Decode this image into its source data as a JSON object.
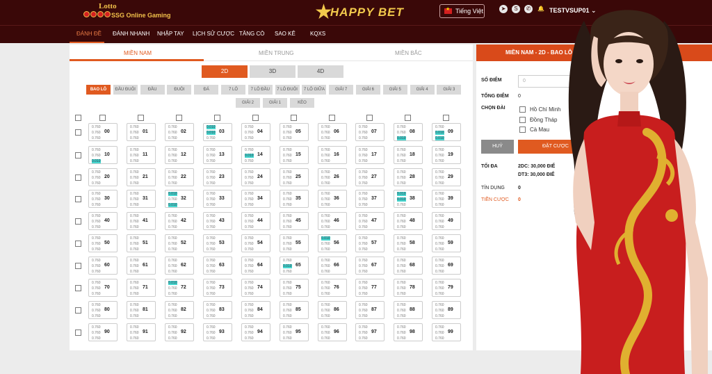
{
  "brand": {
    "lotto_title": "Lotto",
    "lotto_subtitle": "SSG Online Gaming",
    "name": "HAPPY BET"
  },
  "header": {
    "language": "Tiếng Việt",
    "username": "TESTVSUP01"
  },
  "nav": [
    "ĐÁNH ĐỀ",
    "ĐÁNH NHANH",
    "NHẬP TAY",
    "LỊCH SỬ CƯỢC",
    "TĂNG CÒ",
    "SAO KÊ",
    "KQXS"
  ],
  "regions": [
    "MIỀN NAM",
    "MIỀN TRUNG",
    "MIỀN BẮC"
  ],
  "types": [
    "2D",
    "3D",
    "4D"
  ],
  "bet_types_row1": [
    "BAO LÔ",
    "ĐẦU ĐUÔI",
    "ĐẦU",
    "ĐUÔI",
    "ĐÁ",
    "7 LÔ",
    "7 LÔ ĐẦU",
    "7 LÔ ĐUÔI",
    "7 LÔ GIỮA",
    "GIẢI 7",
    "GIẢI 6",
    "GIẢI 5",
    "GIẢI 4",
    "GIẢI 3"
  ],
  "bet_types_row2": [
    "GIẢI 2",
    "GIẢI 1",
    "KÈO"
  ],
  "odds_default": "0.760",
  "odds_highlight": "0.010",
  "highlighted": {
    "03": [
      0,
      1
    ],
    "08": [
      2
    ],
    "09": [
      1,
      2
    ],
    "10": [
      2
    ],
    "14": [
      1
    ],
    "32": [
      0,
      2
    ],
    "38": [
      0,
      1
    ],
    "56": [
      0
    ],
    "65": [
      1
    ],
    "72": [
      0
    ]
  },
  "slip": {
    "title": "MIỀN NAM - 2D - BAO LÔ",
    "points_label": "SỐ ĐIỂM",
    "points_value": "0",
    "total_label": "TỔNG ĐIỂM",
    "total_value": "0",
    "station_label": "CHỌN ĐÀI",
    "stations": [
      "Hồ Chí Minh",
      "Đồng Tháp",
      "Cà Mau"
    ],
    "cancel": "HUỶ",
    "place": "ĐẶT CƯỢC",
    "max_label": "TỐI ĐA",
    "max_line1": "2DC: 30,000 ĐIỂ",
    "max_line2": "DT3: 30,000 ĐIỂ",
    "credit_label": "TÍN DỤNG",
    "credit_value": "0",
    "wager_label": "TIỀN CƯỢC",
    "wager_value": "0"
  },
  "colors": {
    "header": "#3a0808",
    "accent": "#e05a20",
    "highlight": "#48d8d0",
    "dress": "#c81e1e",
    "gold": "#e0b030"
  }
}
